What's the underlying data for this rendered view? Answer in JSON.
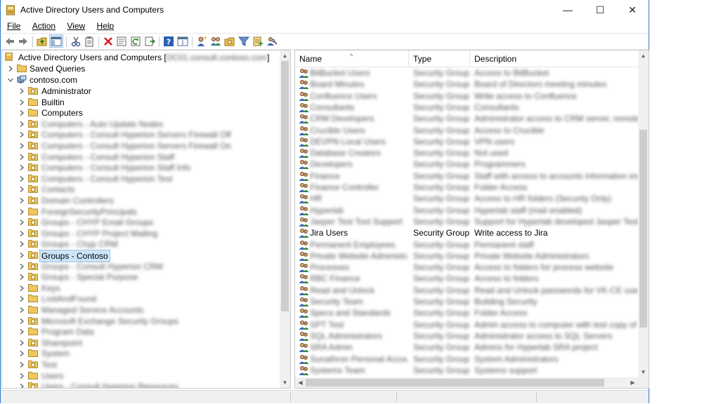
{
  "window": {
    "title": "Active Directory Users and Computers",
    "controls": {
      "minimize": "—",
      "maximize": "☐",
      "close": "✕"
    }
  },
  "menu": [
    "File",
    "Action",
    "View",
    "Help"
  ],
  "toolbar_icons": [
    "back-icon",
    "forward-icon",
    "up-folder-icon",
    "console-tree-icon",
    "cut-icon",
    "copy-icon",
    "delete-icon",
    "properties-icon",
    "refresh-icon",
    "export-list-icon",
    "help-icon",
    "mmc-view-icon",
    "new-user-icon",
    "new-group-icon",
    "new-ou-icon",
    "filter-icon",
    "add-to-group-icon",
    "delegate-control-icon"
  ],
  "tree": {
    "root_label": "Active Directory Users and Computers [",
    "root_label_end": "]",
    "root_server": "DC01.consult.contoso.com",
    "saved_queries": "Saved Queries",
    "domain": "contoso.com",
    "items": [
      {
        "label": "Administrator",
        "blurred": false,
        "ou": true
      },
      {
        "label": "Builtin",
        "blurred": false,
        "ou": false
      },
      {
        "label": "Computers",
        "blurred": false,
        "ou": false
      },
      {
        "label": "Computers - Auto Update Nodes",
        "blurred": true,
        "ou": true
      },
      {
        "label": "Computers - Consult Hyperion Servers Firewall Off",
        "blurred": true,
        "ou": true
      },
      {
        "label": "Computers - Consult Hyperion Servers Firewall On",
        "blurred": true,
        "ou": true
      },
      {
        "label": "Computers - Consult Hyperion Staff",
        "blurred": true,
        "ou": true
      },
      {
        "label": "Computers - Consult Hyperion Staff Info",
        "blurred": true,
        "ou": true
      },
      {
        "label": "Computers - Consult Hyperion Test",
        "blurred": true,
        "ou": true
      },
      {
        "label": "Contacts",
        "blurred": true,
        "ou": true
      },
      {
        "label": "Domain Controllers",
        "blurred": true,
        "ou": true
      },
      {
        "label": "ForeignSecurityPrincipals",
        "blurred": true,
        "ou": false
      },
      {
        "label": "Groups - CHYP Email Groups",
        "blurred": true,
        "ou": true
      },
      {
        "label": "Groups - CHYP Project Mailing",
        "blurred": true,
        "ou": true
      },
      {
        "label": "Groups - Chyp CRM",
        "blurred": true,
        "ou": true
      },
      {
        "label": "Groups - Contoso",
        "blurred": false,
        "ou": true,
        "selected": true
      },
      {
        "label": "Groups - Consult Hyperion CRM",
        "blurred": true,
        "ou": true
      },
      {
        "label": "Groups - Special Purpose",
        "blurred": true,
        "ou": true
      },
      {
        "label": "Keys",
        "blurred": true,
        "ou": false
      },
      {
        "label": "LostAndFound",
        "blurred": true,
        "ou": false
      },
      {
        "label": "Managed Service Accounts",
        "blurred": true,
        "ou": false
      },
      {
        "label": "Microsoft Exchange Security Groups",
        "blurred": true,
        "ou": true
      },
      {
        "label": "Program Data",
        "blurred": true,
        "ou": false
      },
      {
        "label": "Sharepoint",
        "blurred": true,
        "ou": true
      },
      {
        "label": "System",
        "blurred": true,
        "ou": false
      },
      {
        "label": "Test",
        "blurred": true,
        "ou": true
      },
      {
        "label": "Users",
        "blurred": true,
        "ou": false
      },
      {
        "label": "Users - Consult Hyperion Resources",
        "blurred": true,
        "ou": true
      }
    ]
  },
  "list": {
    "columns": [
      "Name",
      "Type",
      "Description"
    ],
    "rows": [
      {
        "name": "BitBucket Users",
        "type": "Security Group...",
        "description": "Access to BitBucket",
        "blurred": true
      },
      {
        "name": "Board Minutes",
        "type": "Security Group...",
        "description": "Board of Directors meeting minutes",
        "blurred": true
      },
      {
        "name": "Confluence Users",
        "type": "Security Group...",
        "description": "Write access to Confluence",
        "blurred": true
      },
      {
        "name": "Consultants",
        "type": "Security Group...",
        "description": "Consultants",
        "blurred": true
      },
      {
        "name": "CRM Developers",
        "type": "Security Group...",
        "description": "Administrator access to CRM server, remote control",
        "blurred": true
      },
      {
        "name": "Crucible Users",
        "type": "Security Group...",
        "description": "Access to Crucible",
        "blurred": true
      },
      {
        "name": "DEVPN Local Users",
        "type": "Security Group...",
        "description": "VPN users",
        "blurred": true
      },
      {
        "name": "Database Creators",
        "type": "Security Group...",
        "description": "Not used",
        "blurred": true
      },
      {
        "name": "Developers",
        "type": "Security Group...",
        "description": "Programmers",
        "blurred": true
      },
      {
        "name": "Finance",
        "type": "Security Group...",
        "description": "Staff with access to accounts information including",
        "blurred": true
      },
      {
        "name": "Finance Controller",
        "type": "Security Group...",
        "description": "Folder Access",
        "blurred": true
      },
      {
        "name": "HR",
        "type": "Security Group...",
        "description": "Access to HR folders (Security Only)",
        "blurred": true
      },
      {
        "name": "Hyperlab",
        "type": "Security Group...",
        "description": "Hyperlab staff (mail enabled)",
        "blurred": true
      },
      {
        "name": "Jasper Test Tool Support",
        "type": "Security Group...",
        "description": "Support for Hyperlab developed Jasper Test Tool",
        "blurred": true
      },
      {
        "name": "Jira Users",
        "type": "Security Group...",
        "description": "Write access to Jira",
        "blurred": false
      },
      {
        "name": "Permanent Employees",
        "type": "Security Group...",
        "description": "Permanent staff",
        "blurred": true
      },
      {
        "name": "Private Website Administrators",
        "type": "Security Group...",
        "description": "Private Website Administrators",
        "blurred": true
      },
      {
        "name": "Processes",
        "type": "Security Group...",
        "description": "Access to folders for process website",
        "blurred": true
      },
      {
        "name": "RBC Finance",
        "type": "Security Group...",
        "description": "Access to folders",
        "blurred": true
      },
      {
        "name": "Read and Unlock",
        "type": "Security Group...",
        "description": "Read and Unlock passwords for VK-CE users",
        "blurred": true
      },
      {
        "name": "Security Team",
        "type": "Security Group...",
        "description": "Building Security",
        "blurred": true
      },
      {
        "name": "Specs and Standards",
        "type": "Security Group...",
        "description": "Folder Access",
        "blurred": true
      },
      {
        "name": "SPT Test",
        "type": "Security Group...",
        "description": "Admin access to computer with test copy of SBPT",
        "blurred": true
      },
      {
        "name": "SQL Administrators",
        "type": "Security Group...",
        "description": "Administrator access to SQL Servers",
        "blurred": true
      },
      {
        "name": "SRA Admin",
        "type": "Security Group...",
        "description": "Admins for Hyperlab SRA project",
        "blurred": true
      },
      {
        "name": "Sunathron Personal Accounts",
        "type": "Security Group...",
        "description": "System Administrators",
        "blurred": true
      },
      {
        "name": "Systems Team",
        "type": "Security Group...",
        "description": "Systems support",
        "blurred": true
      }
    ]
  }
}
